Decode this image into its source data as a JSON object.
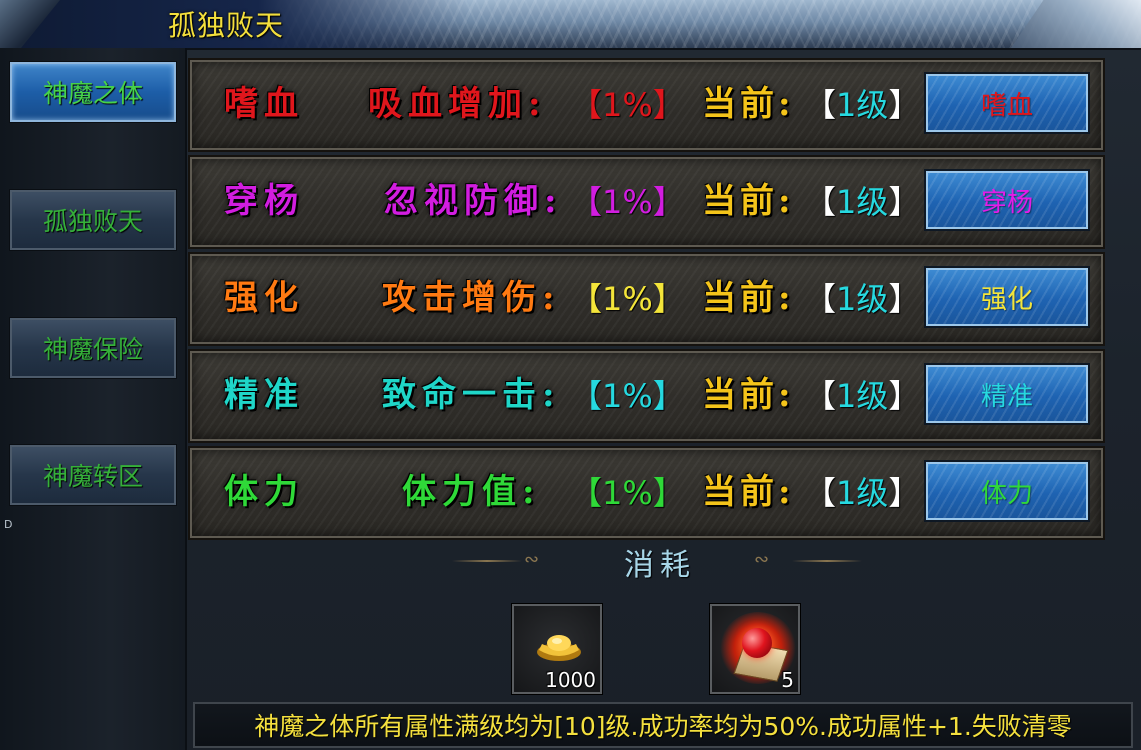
{
  "window": {
    "title": "孤独败天"
  },
  "sidebar": {
    "items": [
      {
        "label": "神魔之体",
        "active": true
      },
      {
        "label": "孤独败天",
        "active": false
      },
      {
        "label": "神魔保险",
        "active": false
      },
      {
        "label": "神魔转区",
        "active": false
      }
    ],
    "side_mark": "D"
  },
  "rows": [
    {
      "name": "嗜血",
      "attr": "吸血增加:",
      "pct": "【1%】",
      "current_label": "当前:",
      "lvl_open": "【",
      "lvl_value": "1级",
      "lvl_close": "】",
      "button": "嗜血",
      "color": "#e0161c",
      "pct_color": "#e0161c",
      "btn_color": "#e0161c"
    },
    {
      "name": "穿杨",
      "attr": "忽视防御:",
      "pct": "【1%】",
      "current_label": "当前:",
      "lvl_open": "【",
      "lvl_value": "1级",
      "lvl_close": "】",
      "button": "穿杨",
      "color": "#d21de0",
      "pct_color": "#d21de0",
      "btn_color": "#e41be8"
    },
    {
      "name": "强化",
      "attr": "攻击增伤:",
      "pct": "【1%】",
      "current_label": "当前:",
      "lvl_open": "【",
      "lvl_value": "1级",
      "lvl_close": "】",
      "button": "强化",
      "color": "#ff7a12",
      "pct_color": "#f4e53a",
      "btn_color": "#f4e53a"
    },
    {
      "name": "精准",
      "attr": "致命一击:",
      "pct": "【1%】",
      "current_label": "当前:",
      "lvl_open": "【",
      "lvl_value": "1级",
      "lvl_close": "】",
      "button": "精准",
      "color": "#1fd6c8",
      "pct_color": "#26d9e0",
      "btn_color": "#26d9e0"
    },
    {
      "name": "体力",
      "attr": "体力值:",
      "pct": "【1%】",
      "current_label": "当前:",
      "lvl_open": "【",
      "lvl_value": "1级",
      "lvl_close": "】",
      "button": "体力",
      "color": "#2fd938",
      "pct_color": "#2fd938",
      "btn_color": "#2fd938"
    }
  ],
  "colors": {
    "current_label": "#f4c41a",
    "level_value": "#26d9e0",
    "title": "#f3df3c",
    "nav_text": "#46d24a"
  },
  "cost": {
    "title": "消耗",
    "items": [
      {
        "icon": "gold-ingot-icon",
        "count": "1000"
      },
      {
        "icon": "red-gem-scroll-icon",
        "count": "5"
      }
    ]
  },
  "footer": {
    "note": "神魔之体所有属性满级均为[10]级.成功率均为50%.成功属性+1.失败清零"
  }
}
